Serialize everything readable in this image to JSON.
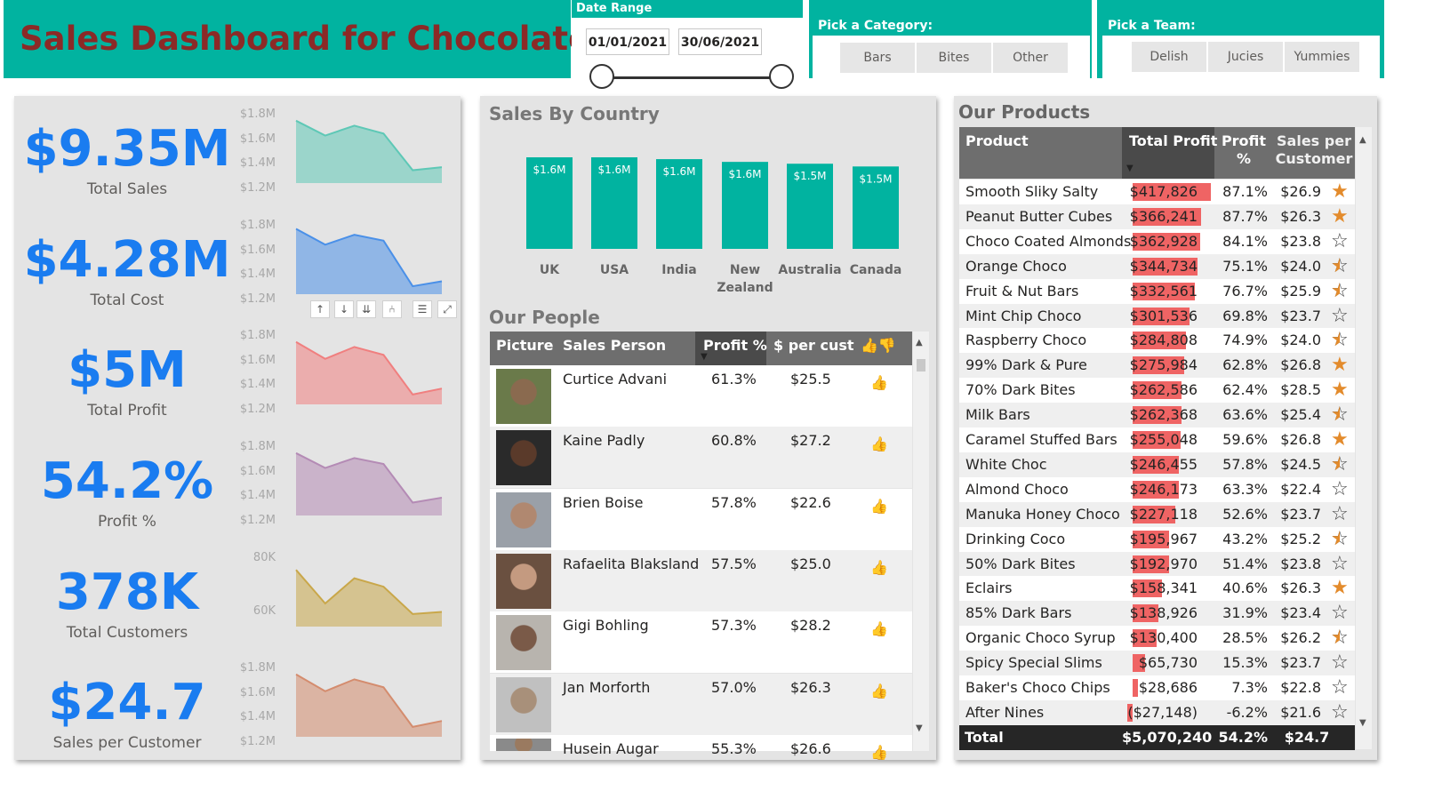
{
  "header": {
    "title": "Sales Dashboard for Chocolates",
    "date_range_label": "Date Range",
    "date_start": "01/01/2021",
    "date_end": "30/06/2021",
    "category_label": "Pick a Category:",
    "categories": [
      "Bars",
      "Bites",
      "Other"
    ],
    "team_label": "Pick a Team:",
    "teams": [
      "Delish",
      "Jucies",
      "Yummies"
    ]
  },
  "kpis": [
    {
      "value": "$9.35M",
      "label": "Total Sales",
      "color": "#5ec8b6",
      "ticks": [
        "$1.8M",
        "$1.6M",
        "$1.4M",
        "$1.2M"
      ],
      "series": [
        1.75,
        1.6,
        1.7,
        1.62,
        1.25,
        1.28
      ]
    },
    {
      "value": "$4.28M",
      "label": "Total Cost",
      "color": "#4a90e8",
      "ticks": [
        "$1.8M",
        "$1.6M",
        "$1.4M",
        "$1.2M"
      ],
      "series": [
        1.78,
        1.62,
        1.72,
        1.66,
        1.2,
        1.25
      ]
    },
    {
      "value": "$5M",
      "label": "Total Profit",
      "color": "#f07f7f",
      "ticks": [
        "$1.8M",
        "$1.6M",
        "$1.4M",
        "$1.2M"
      ],
      "series": [
        1.75,
        1.58,
        1.7,
        1.62,
        1.22,
        1.28
      ]
    },
    {
      "value": "54.2%",
      "label": "Profit %",
      "color": "#b48bb5",
      "ticks": [
        "$1.8M",
        "$1.6M",
        "$1.4M",
        "$1.2M"
      ],
      "series": [
        1.75,
        1.6,
        1.7,
        1.64,
        1.25,
        1.3
      ]
    },
    {
      "value": "378K",
      "label": "Total Customers",
      "color": "#c9a74a",
      "ticks": [
        "80K",
        "60K"
      ],
      "series": [
        72,
        56,
        68,
        64,
        51,
        52
      ]
    },
    {
      "value": "$24.7",
      "label": "Sales per Customer",
      "color": "#d48c6e",
      "ticks": [
        "$1.8M",
        "$1.6M",
        "$1.4M",
        "$1.2M"
      ],
      "series": [
        1.75,
        1.58,
        1.7,
        1.62,
        1.22,
        1.28
      ]
    }
  ],
  "visual_toolbar": [
    "↑",
    "↓",
    "⇊",
    "⑃",
    "☰",
    "⤢"
  ],
  "country": {
    "title": "Sales By Country",
    "chart_data": {
      "type": "bar",
      "categories": [
        "UK",
        "USA",
        "India",
        "New Zealand",
        "Australia",
        "Canada"
      ],
      "values": [
        1.6,
        1.6,
        1.6,
        1.6,
        1.5,
        1.5
      ],
      "labels": [
        "$1.6M",
        "$1.6M",
        "$1.6M",
        "$1.6M",
        "$1.5M",
        "$1.5M"
      ],
      "heights_rel": [
        1.0,
        1.0,
        0.98,
        0.95,
        0.93,
        0.9
      ],
      "color": "#01b3a0"
    },
    "cat_lines": [
      [
        "UK"
      ],
      [
        "USA"
      ],
      [
        "India"
      ],
      [
        "New",
        "Zealand"
      ],
      [
        "Australia"
      ],
      [
        "Canada"
      ]
    ]
  },
  "people": {
    "title": "Our People",
    "columns": [
      "Picture",
      "Sales Person",
      "Profit %",
      "$ per cust",
      "👍👎"
    ],
    "rows": [
      {
        "name": "Curtice Advani",
        "profit": "61.3%",
        "per_cust": "$25.5",
        "thumb": "👍"
      },
      {
        "name": "Kaine Padly",
        "profit": "60.8%",
        "per_cust": "$27.2",
        "thumb": "👍"
      },
      {
        "name": "Brien Boise",
        "profit": "57.8%",
        "per_cust": "$22.6",
        "thumb": "👍"
      },
      {
        "name": "Rafaelita Blaksland",
        "profit": "57.5%",
        "per_cust": "$25.0",
        "thumb": "👍"
      },
      {
        "name": "Gigi Bohling",
        "profit": "57.3%",
        "per_cust": "$28.2",
        "thumb": "👍"
      },
      {
        "name": "Jan Morforth",
        "profit": "57.0%",
        "per_cust": "$26.3",
        "thumb": "👍"
      },
      {
        "name": "Husein Augar",
        "profit": "55.3%",
        "per_cust": "$26.6",
        "thumb": "👍"
      }
    ]
  },
  "products": {
    "title": "Our Products",
    "columns": [
      "Product",
      "Total Profit",
      "Profit %",
      "Sales per Customer"
    ],
    "rows": [
      {
        "name": "Smooth Sliky Salty",
        "profit": "$417,826",
        "profit_num": 417826,
        "pct": "87.1%",
        "spc": "$26.9",
        "star": "full"
      },
      {
        "name": "Peanut Butter Cubes",
        "profit": "$366,241",
        "profit_num": 366241,
        "pct": "87.7%",
        "spc": "$26.3",
        "star": "full"
      },
      {
        "name": "Choco Coated Almonds",
        "profit": "$362,928",
        "profit_num": 362928,
        "pct": "84.1%",
        "spc": "$23.8",
        "star": "empty"
      },
      {
        "name": "Orange Choco",
        "profit": "$344,734",
        "profit_num": 344734,
        "pct": "75.1%",
        "spc": "$24.0",
        "star": "half"
      },
      {
        "name": "Fruit & Nut Bars",
        "profit": "$332,561",
        "profit_num": 332561,
        "pct": "76.7%",
        "spc": "$25.9",
        "star": "half"
      },
      {
        "name": "Mint Chip Choco",
        "profit": "$301,536",
        "profit_num": 301536,
        "pct": "69.8%",
        "spc": "$23.7",
        "star": "empty"
      },
      {
        "name": "Raspberry Choco",
        "profit": "$284,808",
        "profit_num": 284808,
        "pct": "74.9%",
        "spc": "$24.0",
        "star": "half"
      },
      {
        "name": "99% Dark & Pure",
        "profit": "$275,984",
        "profit_num": 275984,
        "pct": "62.8%",
        "spc": "$26.8",
        "star": "full"
      },
      {
        "name": "70% Dark Bites",
        "profit": "$262,586",
        "profit_num": 262586,
        "pct": "62.4%",
        "spc": "$28.5",
        "star": "full"
      },
      {
        "name": "Milk Bars",
        "profit": "$262,368",
        "profit_num": 262368,
        "pct": "63.6%",
        "spc": "$25.4",
        "star": "half"
      },
      {
        "name": "Caramel Stuffed Bars",
        "profit": "$255,048",
        "profit_num": 255048,
        "pct": "59.6%",
        "spc": "$26.8",
        "star": "full"
      },
      {
        "name": "White Choc",
        "profit": "$246,455",
        "profit_num": 246455,
        "pct": "57.8%",
        "spc": "$24.5",
        "star": "half"
      },
      {
        "name": "Almond Choco",
        "profit": "$246,173",
        "profit_num": 246173,
        "pct": "63.3%",
        "spc": "$22.4",
        "star": "empty"
      },
      {
        "name": "Manuka Honey Choco",
        "profit": "$227,118",
        "profit_num": 227118,
        "pct": "52.6%",
        "spc": "$23.7",
        "star": "empty"
      },
      {
        "name": "Drinking Coco",
        "profit": "$195,967",
        "profit_num": 195967,
        "pct": "43.2%",
        "spc": "$25.2",
        "star": "half"
      },
      {
        "name": "50% Dark Bites",
        "profit": "$192,970",
        "profit_num": 192970,
        "pct": "51.4%",
        "spc": "$23.8",
        "star": "empty"
      },
      {
        "name": "Eclairs",
        "profit": "$158,341",
        "profit_num": 158341,
        "pct": "40.6%",
        "spc": "$26.3",
        "star": "full"
      },
      {
        "name": "85% Dark Bars",
        "profit": "$138,926",
        "profit_num": 138926,
        "pct": "31.9%",
        "spc": "$23.4",
        "star": "empty"
      },
      {
        "name": "Organic Choco Syrup",
        "profit": "$130,400",
        "profit_num": 130400,
        "pct": "28.5%",
        "spc": "$26.2",
        "star": "half"
      },
      {
        "name": "Spicy Special Slims",
        "profit": "$65,730",
        "profit_num": 65730,
        "pct": "15.3%",
        "spc": "$23.7",
        "star": "empty"
      },
      {
        "name": "Baker's Choco Chips",
        "profit": "$28,686",
        "profit_num": 28686,
        "pct": "7.3%",
        "spc": "$22.8",
        "star": "empty"
      },
      {
        "name": "After Nines",
        "profit": "($27,148)",
        "profit_num": -27148,
        "pct": "-6.2%",
        "spc": "$21.6",
        "star": "empty"
      }
    ],
    "total": {
      "label": "Total",
      "profit": "$5,070,240",
      "pct": "54.2%",
      "spc": "$24.7"
    }
  },
  "colors": {
    "accent": "#01b3a0",
    "title": "#8b2a27",
    "kpi": "#1a7cf0",
    "neg_bar": "#ef6464",
    "star": "#e38b2c"
  }
}
